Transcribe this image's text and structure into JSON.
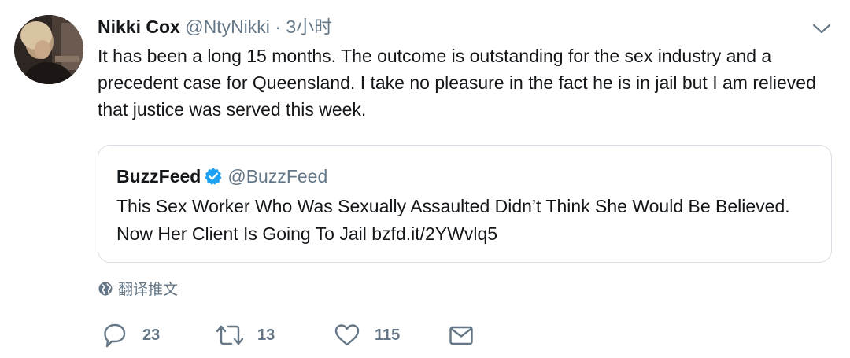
{
  "tweet": {
    "display_name": "Nikki Cox",
    "handle": "@NtyNikki",
    "separator": "·",
    "timestamp": "3小时",
    "text": "It has been a long 15 months. The outcome is outstanding for the sex industry and a precedent case for Queensland. I take no pleasure in the fact he is in jail but I am relieved that justice was served this week."
  },
  "quote": {
    "display_name": "BuzzFeed",
    "handle": "@BuzzFeed",
    "verified": true,
    "text": "This Sex Worker Who Was Sexually Assaulted Didn’t Think She Would Be Believed. Now Her Client Is Going To Jail bzfd.it/2YWvlq5"
  },
  "translate_label": "翻译推文",
  "actions": {
    "reply_count": "23",
    "retweet_count": "13",
    "like_count": "115"
  },
  "icons": {
    "menu": "chevron-down-icon",
    "verified": "verified-badge-icon",
    "translate": "globe-icon",
    "reply": "reply-icon",
    "retweet": "retweet-icon",
    "like": "heart-icon",
    "share": "mail-icon"
  },
  "colors": {
    "text_primary": "#14171a",
    "text_secondary": "#657786",
    "verified_blue": "#1da1f2",
    "border": "#d8dee3"
  }
}
